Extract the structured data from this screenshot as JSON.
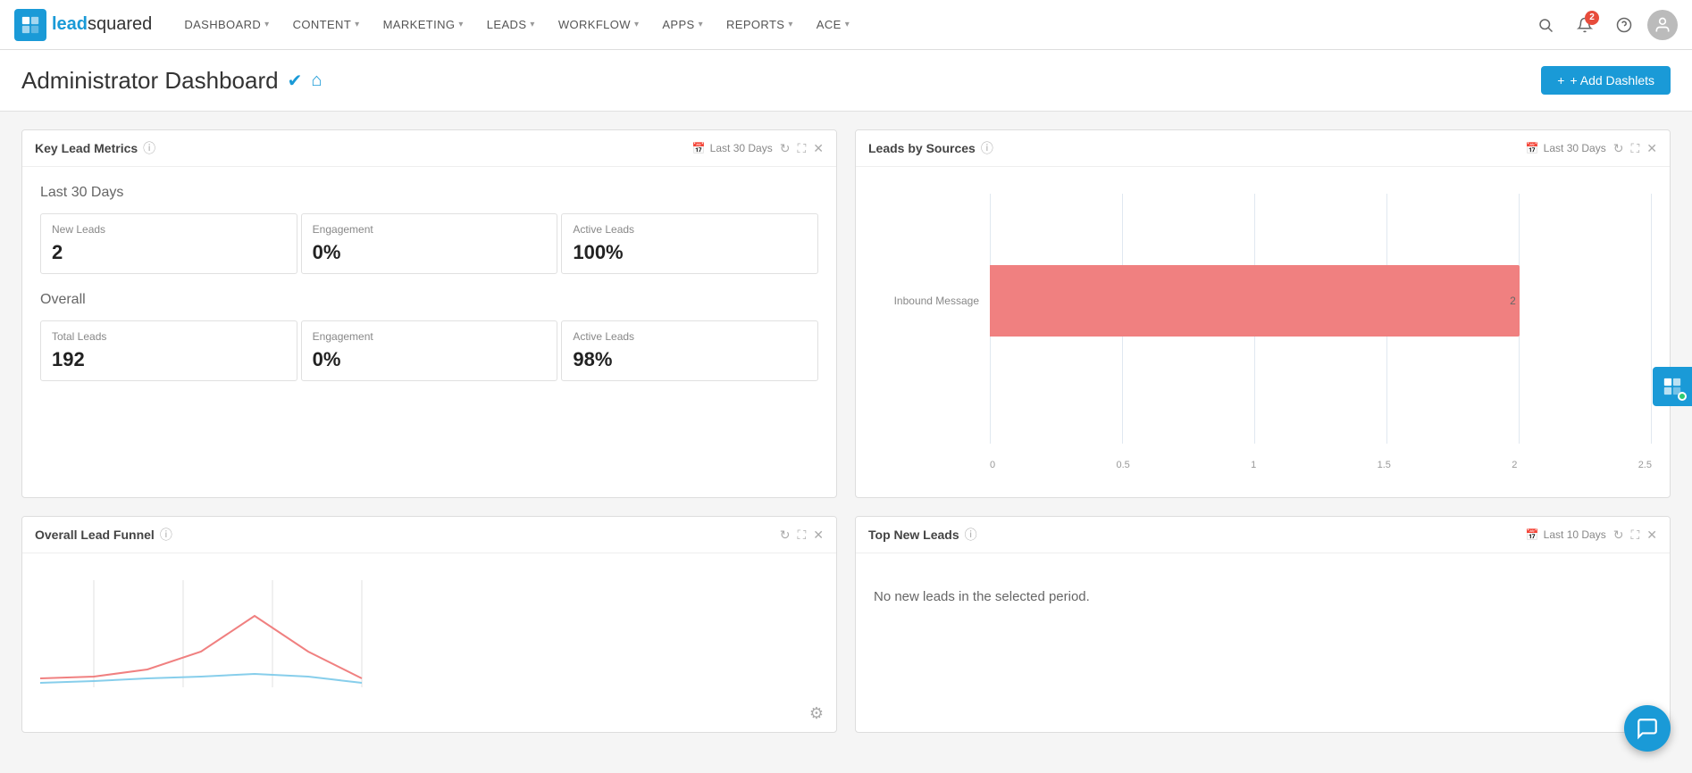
{
  "logo": {
    "icon_text": "LS",
    "text_lead": "lead",
    "text_squared": "squared"
  },
  "nav": {
    "items": [
      {
        "label": "DASHBOARD",
        "id": "dashboard"
      },
      {
        "label": "CONTENT",
        "id": "content"
      },
      {
        "label": "MARKETING",
        "id": "marketing"
      },
      {
        "label": "LEADS",
        "id": "leads"
      },
      {
        "label": "WORKFLOW",
        "id": "workflow"
      },
      {
        "label": "APPS",
        "id": "apps"
      },
      {
        "label": "REPORTS",
        "id": "reports"
      },
      {
        "label": "ACE",
        "id": "ace"
      }
    ],
    "notification_count": "2"
  },
  "page": {
    "title": "Administrator Dashboard",
    "add_dashlets_label": "+ Add Dashlets"
  },
  "key_lead_metrics": {
    "title": "Key Lead Metrics",
    "date_range": "Last 30 Days",
    "period_label": "Last 30 Days",
    "last30": {
      "new_leads_label": "New Leads",
      "new_leads_value": "2",
      "engagement_label": "Engagement",
      "engagement_value": "0%",
      "active_leads_label": "Active Leads",
      "active_leads_value": "100%"
    },
    "overall_label": "Overall",
    "overall": {
      "total_leads_label": "Total Leads",
      "total_leads_value": "192",
      "engagement_label": "Engagement",
      "engagement_value": "0%",
      "active_leads_label": "Active Leads",
      "active_leads_value": "98%"
    }
  },
  "leads_by_sources": {
    "title": "Leads by Sources",
    "date_range": "Last 30 Days",
    "bar": {
      "label": "Inbound Message",
      "value": 2,
      "max": 2.5
    },
    "x_axis": [
      "0",
      "0.5",
      "1",
      "1.5",
      "2",
      "2.5"
    ]
  },
  "overall_lead_funnel": {
    "title": "Overall Lead Funnel",
    "date_range": null
  },
  "top_new_leads": {
    "title": "Top New Leads",
    "date_range": "Last 10 Days",
    "no_leads_message": "No new leads in the selected period."
  },
  "icons": {
    "calendar": "📅",
    "refresh": "↻",
    "expand": "⛶",
    "close": "✕",
    "info": "ⓘ",
    "search": "🔍",
    "bell": "🔔",
    "help": "?",
    "user": "👤",
    "chat": "💬",
    "gear": "⚙",
    "verified": "✔",
    "home": "⌂",
    "plus": "+"
  },
  "colors": {
    "brand_blue": "#1a9ad7",
    "bar_color": "#f08080",
    "badge_red": "#e74c3c"
  }
}
